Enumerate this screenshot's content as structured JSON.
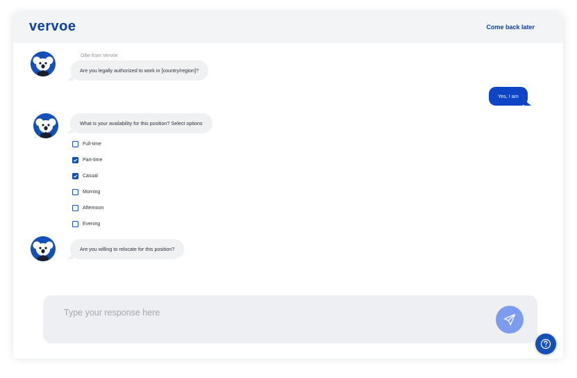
{
  "header": {
    "logo_text": "vervoe",
    "come_back_label": "Come back later"
  },
  "chat": {
    "sender_name": "Ollie from Vervoe",
    "messages": [
      {
        "from": "bot",
        "text": "Are you legally authorized to work in [country/region]?"
      },
      {
        "from": "user",
        "text": "Yes, I am"
      },
      {
        "from": "bot",
        "text": "What is your availability for this position? Select options"
      },
      {
        "from": "bot",
        "text": "Are you willing to relocate for this position?"
      }
    ],
    "options": [
      {
        "label": "Full-time",
        "checked": false
      },
      {
        "label": "Part-time",
        "checked": true
      },
      {
        "label": "Casual",
        "checked": true
      },
      {
        "label": "Morning",
        "checked": false
      },
      {
        "label": "Afternoon",
        "checked": false
      },
      {
        "label": "Evening",
        "checked": false
      }
    ]
  },
  "composer": {
    "placeholder": "Type your response here",
    "send_icon": "paper-plane-icon"
  },
  "help": {
    "icon": "question-mark-icon"
  },
  "colors": {
    "brand": "#0b3fa7",
    "user_bubble": "#0e44c6",
    "send_button": "#7c9cf0",
    "checkbox": "#1450b8"
  }
}
